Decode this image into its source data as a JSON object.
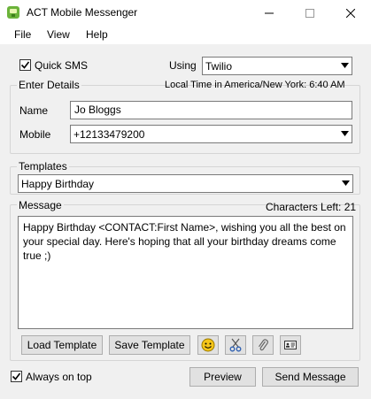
{
  "window": {
    "title": "ACT Mobile Messenger"
  },
  "menu": {
    "file": "File",
    "view": "View",
    "help": "Help"
  },
  "quick_sms": {
    "label": "Quick SMS",
    "checked": true
  },
  "using": {
    "label": "Using",
    "value": "Twilio"
  },
  "details": {
    "group_label": "Enter Details",
    "local_time": "Local Time in America/New York: 6:40 AM",
    "name_label": "Name",
    "name_value": "Jo Bloggs",
    "mobile_label": "Mobile",
    "mobile_value": "+12133479200"
  },
  "templates": {
    "group_label": "Templates",
    "value": "Happy Birthday"
  },
  "message": {
    "group_label": "Message",
    "chars_left": "Characters Left: 21",
    "text": "Happy Birthday <CONTACT:First Name>, wishing you all the best on your special day. Here's hoping that all your birthday dreams come true ;)"
  },
  "buttons": {
    "load_template": "Load Template",
    "save_template": "Save Template",
    "preview": "Preview",
    "send": "Send Message"
  },
  "icons": {
    "emoji": "smiley-icon",
    "cut": "scissors-icon",
    "attach": "paperclip-icon",
    "contact": "contact-card-icon"
  },
  "always_on_top": {
    "label": "Always on top",
    "checked": true
  }
}
